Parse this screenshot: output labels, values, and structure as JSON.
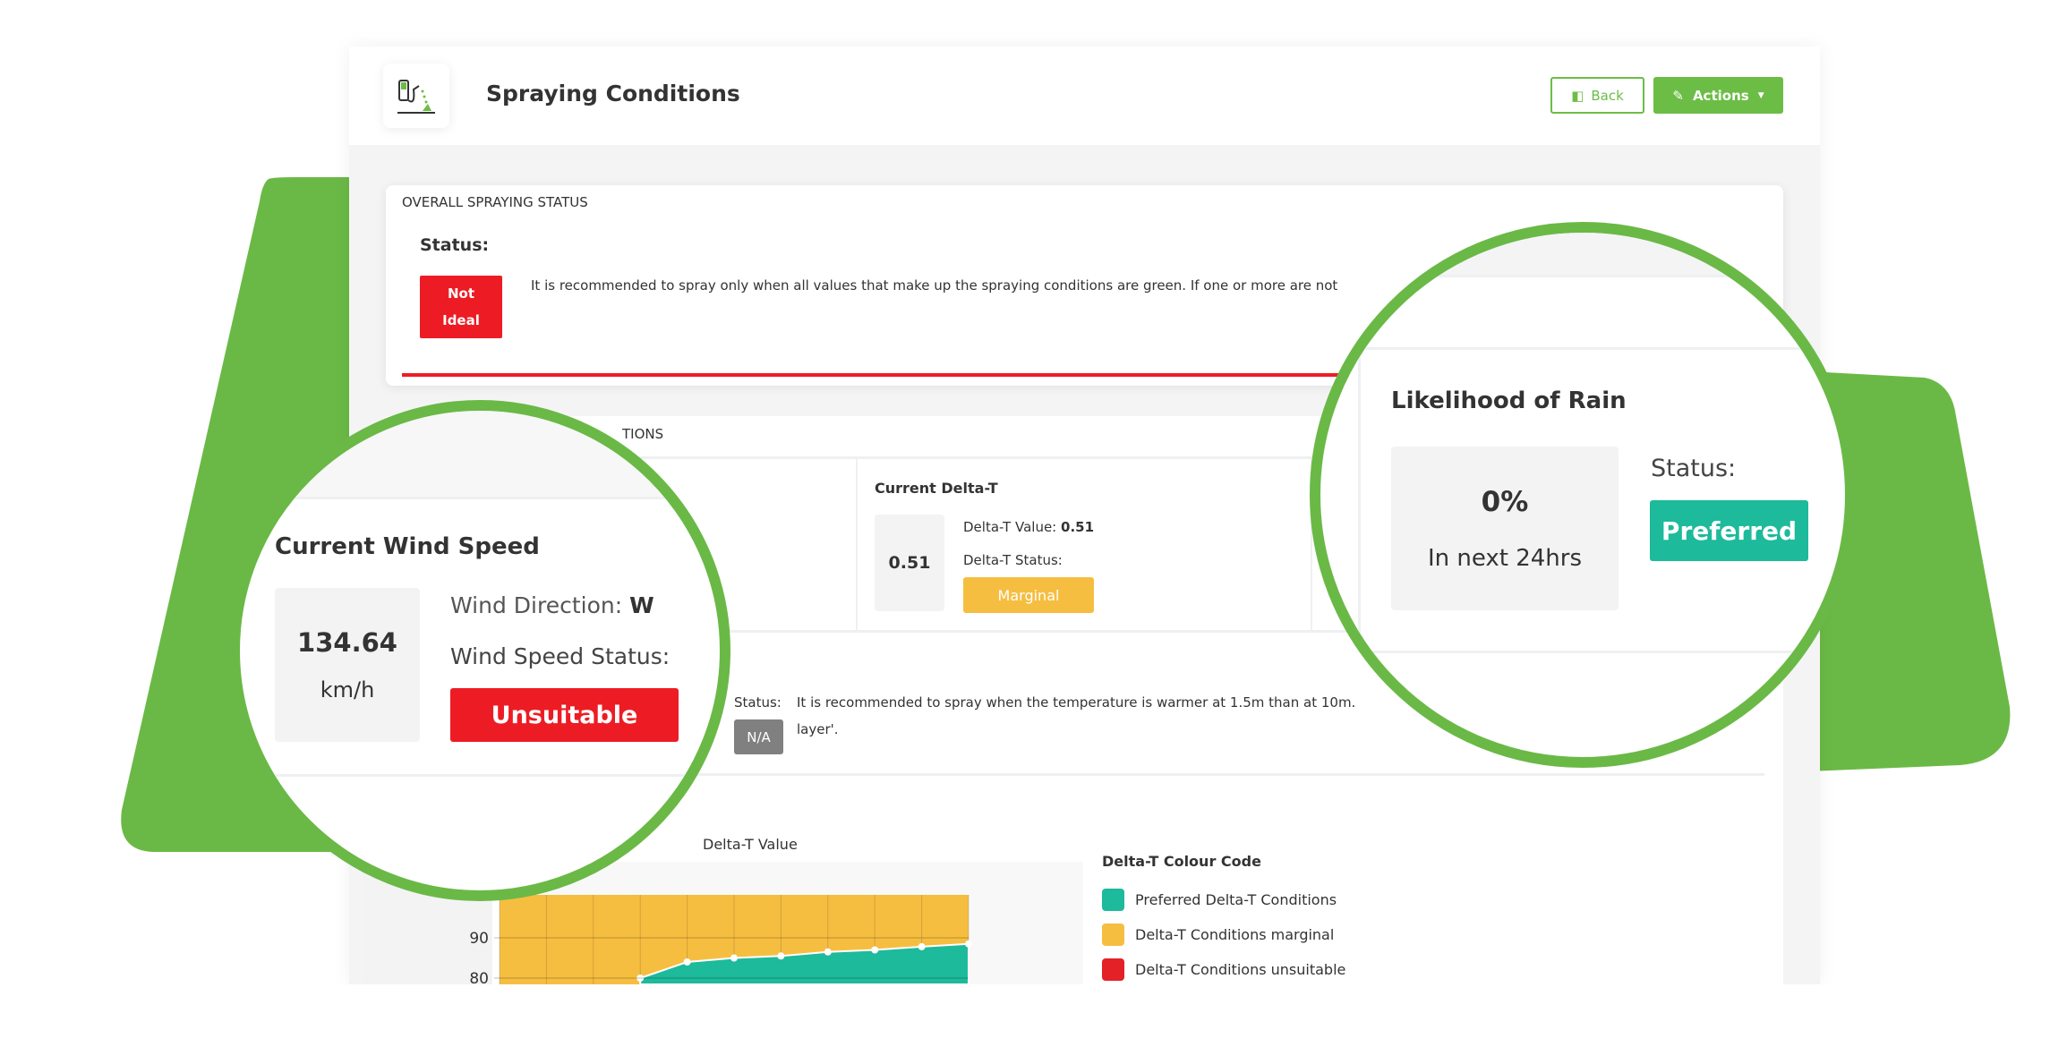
{
  "header": {
    "title": "Spraying Conditions",
    "back_label": "Back",
    "actions_label": "Actions"
  },
  "overall": {
    "heading": "OVERALL SPRAYING STATUS",
    "status_label": "Status:",
    "badge_line1": "Not",
    "badge_line2": "Ideal",
    "message": "It is recommended to spray only when all values that make up the spraying conditions are green. If one or more are not"
  },
  "conditions": {
    "heading_fragment": "TIONS"
  },
  "delta_t": {
    "title": "Current Delta-T",
    "value": "0.51",
    "value_label": "Delta-T Value:",
    "value_text": "0.51",
    "status_label": "Delta-T Status:",
    "status": "Marginal"
  },
  "inversion": {
    "status_label": "Status:",
    "message": "It is recommended to spray when the temperature is warmer at 1.5m than at 10m.",
    "message_tail": "layer'.",
    "badge": "N/A"
  },
  "wind": {
    "title": "Current Wind Speed",
    "value": "134.64",
    "unit": "km/h",
    "direction_label": "Wind Direction:",
    "direction": "W",
    "status_label": "Wind Speed Status:",
    "status": "Unsuitable"
  },
  "rain": {
    "title": "Likelihood of Rain",
    "value": "0%",
    "period": "In next 24hrs",
    "status_label": "Status:",
    "status": "Preferred"
  },
  "legend": {
    "title": "Delta-T Colour Code",
    "items": [
      {
        "label": "Preferred Delta-T Conditions",
        "color": "#1dba9b"
      },
      {
        "label": "Delta-T Conditions marginal",
        "color": "#f6be41"
      },
      {
        "label": "Delta-T Conditions unsuitable",
        "color": "#e32127"
      }
    ]
  },
  "colors": {
    "brand_green": "#6cbd45",
    "red": "#ed1c24",
    "marginal": "#f6be41",
    "preferred": "#1dba9b",
    "na": "#808080"
  },
  "chart_data": {
    "type": "area",
    "title": "Delta-T Value",
    "yticks": [
      90,
      80
    ],
    "ylim": [
      78,
      100
    ],
    "grid": true,
    "series": [
      {
        "values": [
          80,
          84,
          85,
          85.5,
          86.5,
          87,
          87.8,
          88.5
        ],
        "color": "#1dba9b"
      }
    ],
    "background_band_color": "#f6be41"
  }
}
